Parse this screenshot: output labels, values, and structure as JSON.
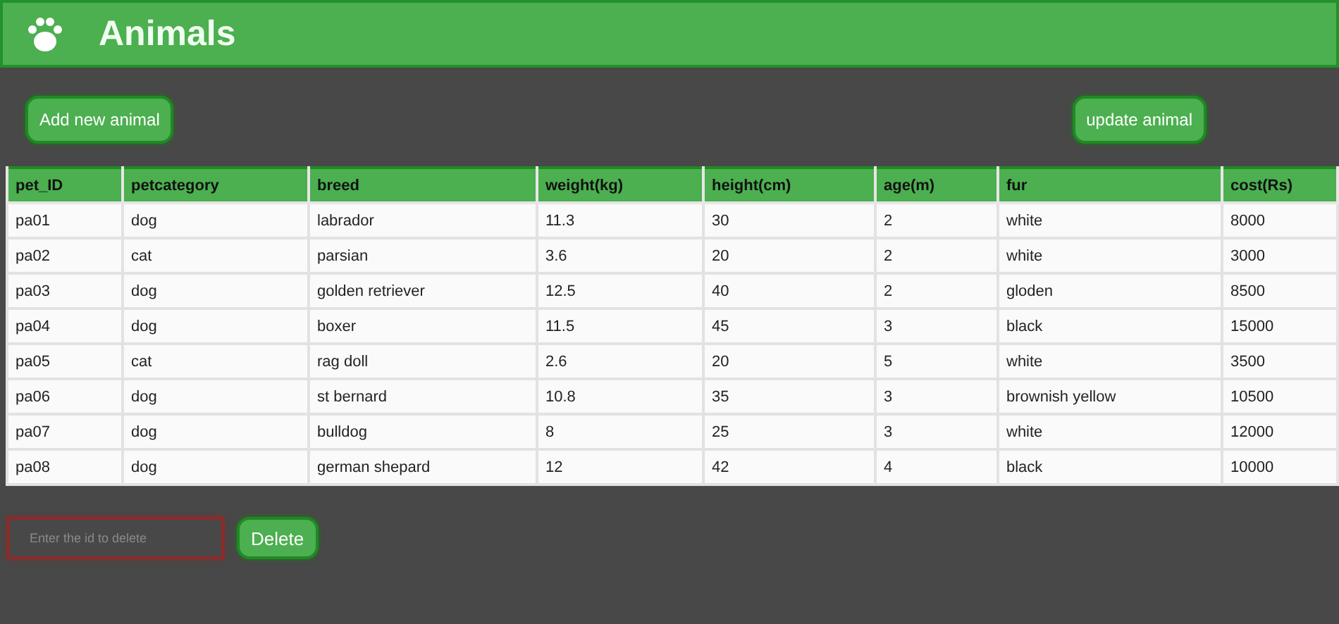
{
  "header": {
    "title": "Animals"
  },
  "actions": [
    {
      "label": "Add new animal"
    },
    {
      "label": "update animal"
    }
  ],
  "table": {
    "columns": [
      "pet_ID",
      "petcategory",
      "breed",
      "weight(kg)",
      "height(cm)",
      "age(m)",
      "fur",
      "cost(Rs)"
    ],
    "rows": [
      [
        "pa01",
        "dog",
        "labrador",
        "11.3",
        "30",
        "2",
        "white",
        "8000"
      ],
      [
        "pa02",
        "cat",
        "parsian",
        "3.6",
        "20",
        "2",
        "white",
        "3000"
      ],
      [
        "pa03",
        "dog",
        "golden retriever",
        "12.5",
        "40",
        "2",
        "gloden",
        "8500"
      ],
      [
        "pa04",
        "dog",
        "boxer",
        "11.5",
        "45",
        "3",
        "black",
        "15000"
      ],
      [
        "pa05",
        "cat",
        "rag doll",
        "2.6",
        "20",
        "5",
        "white",
        "3500"
      ],
      [
        "pa06",
        "dog",
        "st bernard",
        "10.8",
        "35",
        "3",
        "brownish yellow",
        "10500"
      ],
      [
        "pa07",
        "dog",
        "bulldog",
        "8",
        "25",
        "3",
        "white",
        "12000"
      ],
      [
        "pa08",
        "dog",
        "german shepard",
        "12",
        "42",
        "4",
        "black",
        "10000"
      ]
    ]
  },
  "delete": {
    "placeholder": "Enter the id to delete",
    "button": "Delete"
  }
}
